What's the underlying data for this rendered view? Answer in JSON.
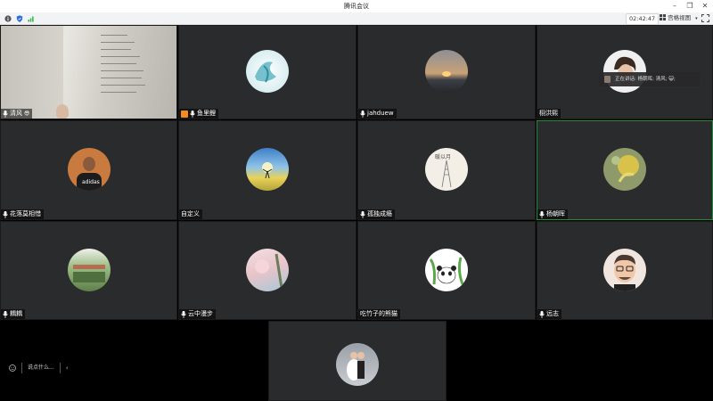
{
  "window": {
    "title": "腾讯会议"
  },
  "toolbar": {
    "timer": "02:42:47",
    "view_label": "宫格视图",
    "icons": [
      "info-icon",
      "shield-icon",
      "signal-icon",
      "grid-view-icon",
      "chevron-down-icon",
      "fullscreen-icon"
    ]
  },
  "colors": {
    "tile_bg": "#2a2b2d",
    "active_border": "#1e8e3e",
    "host_badge": "#f58a1f",
    "signal_green": "#2fb344",
    "shield_blue": "#2b6fdf"
  },
  "participants": [
    {
      "name": "清风",
      "video": true
    },
    {
      "name": "鱼里鲤",
      "host": true
    },
    {
      "name": "jahduew"
    },
    {
      "name": "栩洪熙"
    },
    {
      "name": "花落莫相惜"
    },
    {
      "name": "自定义"
    },
    {
      "name": "孤独成瘾"
    },
    {
      "name": "杨朝晖",
      "active": true
    },
    {
      "name": "耦耦"
    },
    {
      "name": "云中漫步"
    },
    {
      "name": "吃竹子的熊猫"
    },
    {
      "name": "远志"
    },
    {
      "name": ""
    }
  ],
  "speaking": {
    "text": "正在讲话: 杨朝晖; 清风; 😺;"
  },
  "chat": {
    "placeholder": "说点什么..."
  },
  "avatar_art": {
    "tile7": "暖以月"
  }
}
